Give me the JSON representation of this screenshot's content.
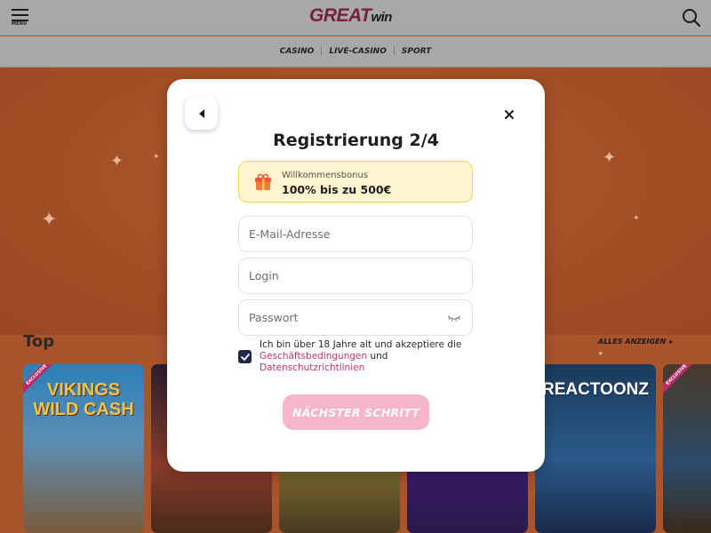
{
  "header": {
    "menu_label": "MENU",
    "logo_main": "GREAT",
    "logo_suffix": "win"
  },
  "nav": {
    "items": [
      "CASINO",
      "LIVE-CASINO",
      "SPORT"
    ]
  },
  "games_section": {
    "title": "Top",
    "show_all": "ALLES ANZEIGEN",
    "games": [
      {
        "name": "VIKINGS WILD CASH",
        "ribbon": "EXCLUSIVE"
      },
      {
        "name": "",
        "ribbon": ""
      },
      {
        "name": "",
        "ribbon": ""
      },
      {
        "name": "",
        "ribbon": ""
      },
      {
        "name": "REACTOONZ",
        "ribbon": ""
      },
      {
        "name": "",
        "ribbon": "EXCLUSIVE"
      }
    ]
  },
  "modal": {
    "title": "Registrierung 2/4",
    "bonus": {
      "label": "Willkommensbonus",
      "value": "100% bis zu 500€"
    },
    "email": {
      "placeholder": "E-Mail-Adresse",
      "value": ""
    },
    "login": {
      "placeholder": "Login",
      "value": ""
    },
    "password": {
      "placeholder": "Passwort",
      "value": ""
    },
    "terms": {
      "checked": true,
      "text_before": "Ich bin über 18 Jahre alt und akzeptiere die ",
      "link_terms": "Geschäftsbedingungen",
      "text_and": " und ",
      "link_privacy": "Datenschutzrichtlinien"
    },
    "next_button": "NÄCHSTER SCHRITT"
  },
  "colors": {
    "accent": "#c2336f",
    "button_disabled": "#f5b6ca",
    "bonus_bg": "#fdf5cf",
    "checkbox": "#1f2a4a"
  }
}
